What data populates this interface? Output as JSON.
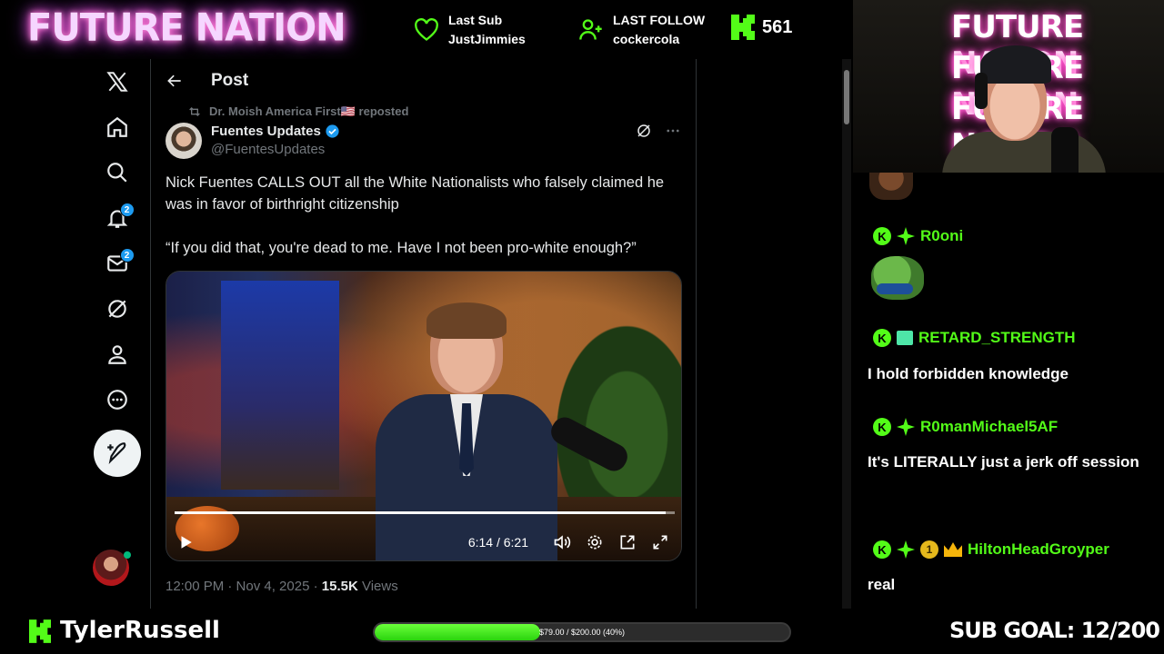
{
  "overlay": {
    "brand": "FUTURE NATION",
    "last_sub_label": "Last Sub",
    "last_sub_name": "JustJimmies",
    "last_follow_label": "LAST FOLLOW",
    "last_follow_name": "cockercola",
    "viewer_count": "561",
    "streamer_name": "TylerRussell",
    "goal_text": "$79.00 / $200.00 (40%)",
    "goal_progress": 0.4,
    "sub_goal": "SUB GOAL: 12/200",
    "neon_lines": [
      "FUTURE NATION",
      "FUTURE NATION",
      "FUTURE NATION"
    ],
    "accent": "#53fc18"
  },
  "x": {
    "nav": [
      {
        "name": "x-logo-icon"
      },
      {
        "name": "home-icon"
      },
      {
        "name": "search-icon"
      },
      {
        "name": "notifications-icon",
        "badge": "2"
      },
      {
        "name": "messages-icon",
        "badge": "2"
      },
      {
        "name": "grok-icon"
      },
      {
        "name": "profile-icon"
      },
      {
        "name": "more-icon"
      }
    ],
    "header_title": "Post",
    "repost_text": "Dr. Moish America First🇺🇸 reposted",
    "author_name": "Fuentes Updates",
    "author_handle": "@FuentesUpdates",
    "post_paragraph_1": "Nick Fuentes CALLS OUT all the White Nationalists who falsely claimed he was in favor of birthright citizenship",
    "post_paragraph_2": "“If you did that, you're dead to me. Have I not been pro-white enough?”",
    "video_time": "6:14 / 6:21",
    "video_progress": 0.981,
    "meta_time": "12:00 PM · Nov 4, 2025 · ",
    "meta_views_count": "15.5K",
    "meta_views_label": " Views",
    "accent": "#1d9bf0"
  },
  "chat": {
    "messages": [
      {
        "user": "R0oni",
        "text": ""
      },
      {
        "user": "RETARD_STRENGTH",
        "text": "I hold forbidden knowledge"
      },
      {
        "user": "R0manMichael5AF",
        "text": "It's LITERALLY just a jerk off session"
      },
      {
        "user": "HiltonHeadGroyper",
        "text": "real",
        "badge_number": "1"
      }
    ]
  }
}
